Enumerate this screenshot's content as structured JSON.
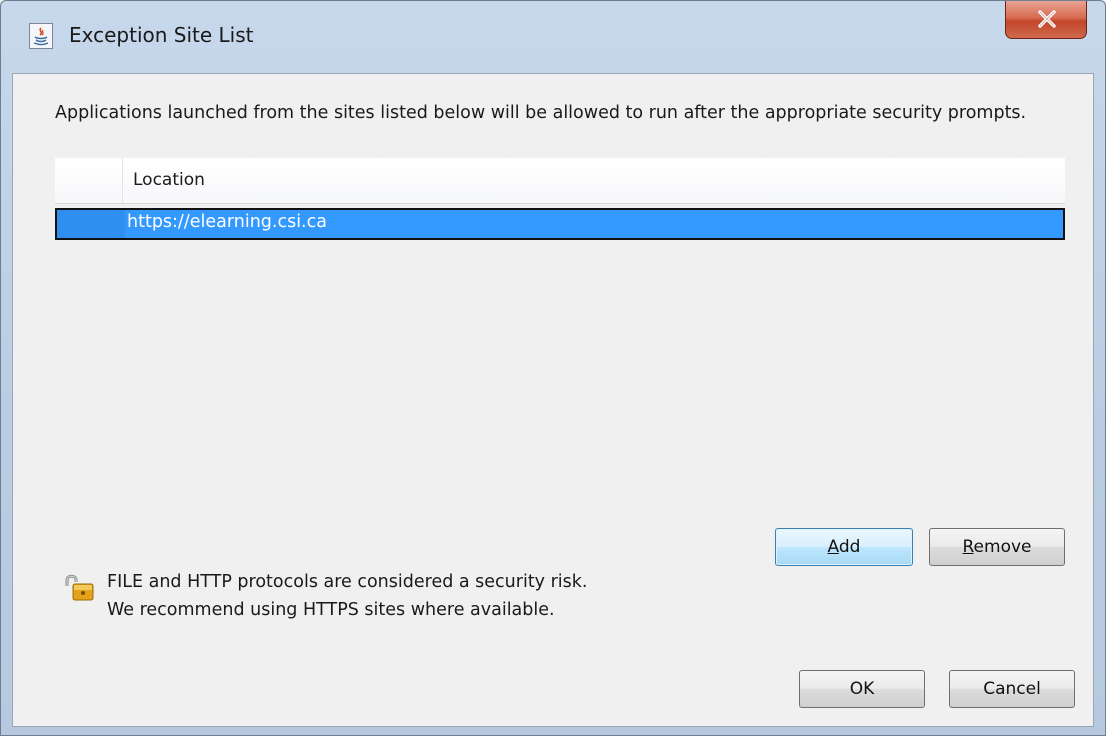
{
  "window": {
    "title": "Exception Site List",
    "icon": "java-icon",
    "close_icon": "close-icon"
  },
  "description": "Applications launched from the sites listed below will be allowed to run after the appropriate security prompts.",
  "table": {
    "header": "Location",
    "rows": [
      {
        "location": "https://elearning.csi.ca",
        "selected": true
      }
    ]
  },
  "buttons": {
    "add": {
      "mnemonic": "A",
      "rest": "dd"
    },
    "remove": {
      "mnemonic": "R",
      "rest": "emove"
    },
    "ok": "OK",
    "cancel": "Cancel"
  },
  "warning": {
    "icon": "unlocked-padlock-icon",
    "line1": "FILE and HTTP protocols are considered a security risk.",
    "line2": "We recommend using HTTPS sites where available."
  },
  "colors": {
    "selection": "#3399ff",
    "close_button": "#c7452a"
  }
}
